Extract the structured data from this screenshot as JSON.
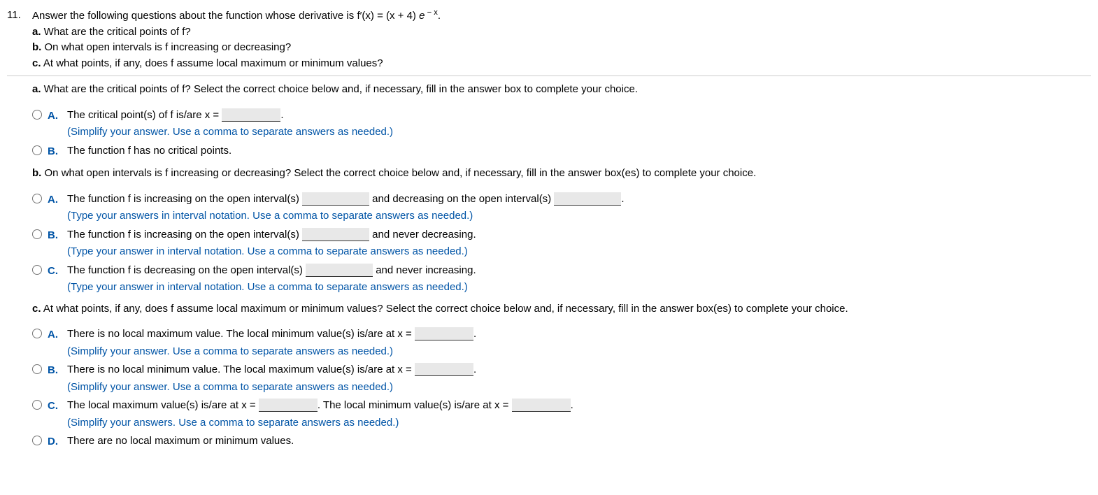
{
  "question_number": "11.",
  "stem": {
    "lead_text": "Answer the following questions about the function whose derivative is ",
    "formula_pre": "f′(x) = (x + 4) ",
    "formula_base": "e",
    "formula_exp": " − x",
    "formula_tail": ".",
    "parts": {
      "a_bold": "a.",
      "a_text": " What are the critical points of f?",
      "b_bold": "b.",
      "b_text": " On what open intervals is f increasing or decreasing?",
      "c_bold": "c.",
      "c_text": " At what points, if any, does f assume local maximum or minimum values?"
    }
  },
  "part_a": {
    "prompt_bold": "a.",
    "prompt_text": " What are the critical points of f? Select the correct choice below and, if necessary, fill in the answer box to complete your choice.",
    "choices": {
      "A": {
        "label": "A.",
        "pre": "The critical point(s) of f is/are x = ",
        "post": ".",
        "hint": "(Simplify your answer. Use a comma to separate answers as needed.)"
      },
      "B": {
        "label": "B.",
        "text": "The function f has no critical points."
      }
    }
  },
  "part_b": {
    "prompt_bold": "b.",
    "prompt_text": " On what open intervals is f increasing or decreasing? Select the correct choice below and, if necessary, fill in the answer box(es) to complete your choice.",
    "choices": {
      "A": {
        "label": "A.",
        "seg1": "The function f is increasing on the open interval(s) ",
        "seg2": " and decreasing on the open interval(s) ",
        "seg3": ".",
        "hint": "(Type your answers in interval notation. Use a comma to separate answers as needed.)"
      },
      "B": {
        "label": "B.",
        "seg1": "The function f is increasing on the open interval(s) ",
        "seg2": " and never decreasing.",
        "hint": "(Type your answer in interval notation. Use a comma to separate answers as needed.)"
      },
      "C": {
        "label": "C.",
        "seg1": "The function f is decreasing on the open interval(s) ",
        "seg2": " and never increasing.",
        "hint": "(Type your answer in interval notation. Use a comma to separate answers as needed.)"
      }
    }
  },
  "part_c": {
    "prompt_bold": "c.",
    "prompt_text": " At what points, if any, does f assume local maximum or minimum values? Select the correct choice below and, if necessary, fill in the answer box(es) to complete your choice.",
    "choices": {
      "A": {
        "label": "A.",
        "seg1": "There is no local maximum value. The local minimum value(s) is/are at x = ",
        "seg2": ".",
        "hint": "(Simplify your answer. Use a comma to separate answers as needed.)"
      },
      "B": {
        "label": "B.",
        "seg1": "There is no local minimum value. The local maximum value(s) is/are at x = ",
        "seg2": ".",
        "hint": "(Simplify your answer. Use a comma to separate answers as needed.)"
      },
      "C": {
        "label": "C.",
        "seg1": "The local maximum value(s) is/are at x = ",
        "seg2": ". The local minimum value(s) is/are at x = ",
        "seg3": ".",
        "hint": "(Simplify your answers. Use a comma to separate answers as needed.)"
      },
      "D": {
        "label": "D.",
        "text": "There are no local maximum or minimum values."
      }
    }
  }
}
